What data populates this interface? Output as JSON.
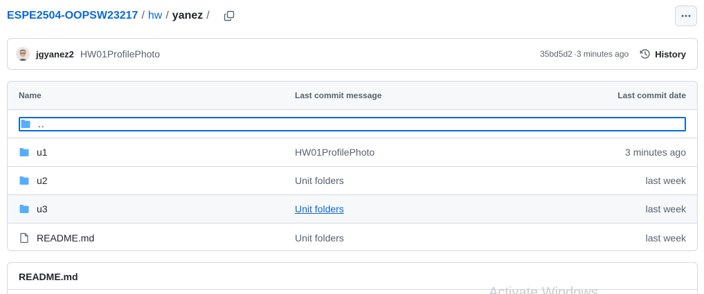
{
  "breadcrumb": {
    "repo": "ESPE2504-OOPSW23217",
    "separator": "/",
    "folder": "hw",
    "current": "yanez",
    "trailing": "/"
  },
  "icons": {
    "copy": "copy-icon",
    "more": "kebab-horizontal-icon",
    "history": "history-icon",
    "folder": "folder-icon",
    "file": "file-icon"
  },
  "colors": {
    "link": "#0969da",
    "folder": "#54aeff",
    "border": "#d1d9e0",
    "muted": "#59636e"
  },
  "commit": {
    "author": "jgyanez2",
    "message": "HW01ProfilePhoto",
    "sha": "35bd5d2",
    "dot": " · ",
    "time": "3 minutes ago",
    "history_label": "History"
  },
  "table": {
    "headers": {
      "name": "Name",
      "message": "Last commit message",
      "date": "Last commit date"
    },
    "parent": "..",
    "rows": [
      {
        "name": "u1",
        "type": "folder",
        "message": "HW01ProfilePhoto",
        "date": "3 minutes ago"
      },
      {
        "name": "u2",
        "type": "folder",
        "message": "Unit folders",
        "date": "last week"
      },
      {
        "name": "u3",
        "type": "folder",
        "message": "Unit folders",
        "date": "last week"
      },
      {
        "name": "README.md",
        "type": "file",
        "message": "Unit folders",
        "date": "last week"
      }
    ]
  },
  "readme": {
    "title": "README.md"
  },
  "watermark": "Activate Windows"
}
